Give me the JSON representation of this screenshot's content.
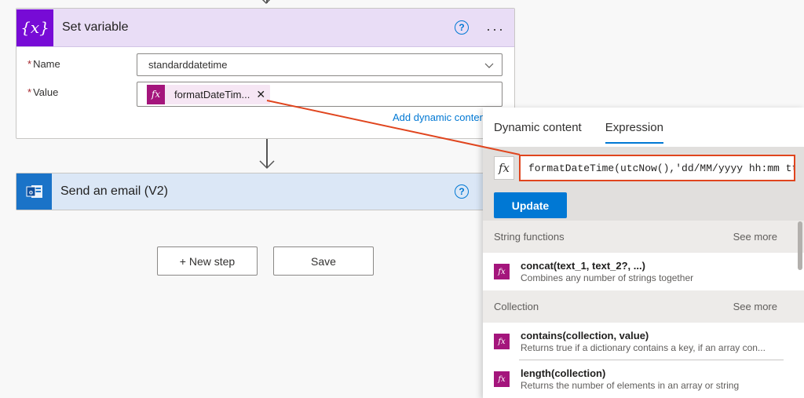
{
  "flow": {
    "set_variable": {
      "title": "Set variable",
      "icon": "variable-icon",
      "icon_glyph": "{x}",
      "help_glyph": "?",
      "more_glyph": "···",
      "fields": [
        {
          "label": "Name",
          "required_mark": "*",
          "value": "standarddatetime"
        },
        {
          "label": "Value",
          "required_mark": "*",
          "token_label": "formatDateTim...",
          "token_icon_glyph": "fx",
          "token_remove_glyph": "✕"
        }
      ],
      "add_dynamic_content": "Add dynamic content"
    },
    "send_email": {
      "title": "Send an email (V2)",
      "icon": "outlook-icon",
      "help_glyph": "?"
    },
    "buttons": {
      "new_step": "+ New step",
      "save": "Save"
    }
  },
  "panel": {
    "tabs": [
      {
        "label": "Dynamic content",
        "active": false
      },
      {
        "label": "Expression",
        "active": true
      }
    ],
    "expression_fx_glyph": "fx",
    "expression_value": "formatDateTime(utcNow(),'dd/MM/yyyy hh:mm tt')",
    "update_label": "Update",
    "sections": [
      {
        "title": "String functions",
        "see_more": "See more",
        "items": [
          {
            "name": "concat(text_1, text_2?, ...)",
            "description": "Combines any number of strings together"
          }
        ]
      },
      {
        "title": "Collection",
        "see_more": "See more",
        "items": [
          {
            "name": "contains(collection, value)",
            "description": "Returns true if a dictionary contains a key, if an array con..."
          },
          {
            "name": "length(collection)",
            "description": "Returns the number of elements in an array or string"
          }
        ]
      }
    ]
  },
  "colors": {
    "accent": "#0078d4",
    "variable_purple": "#770bd6",
    "expression_magenta": "#a4157c",
    "annotation_red": "#e0451e"
  }
}
